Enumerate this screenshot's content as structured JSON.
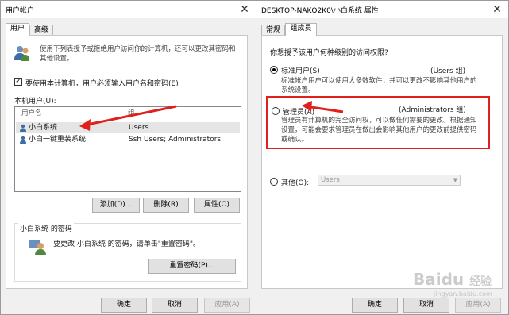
{
  "left_window": {
    "title": "用户帐户",
    "close_glyph": "✕",
    "tabs": [
      {
        "label": "用户"
      },
      {
        "label": "高级"
      }
    ],
    "intro_text": "使用下列表授予或拒绝用户访问你的计算机，还可以更改其密码和其他设置。",
    "require_login_checkbox": {
      "checked": true,
      "check_glyph": "✓",
      "label": "要使用本计算机，用户必须输入用户名和密码(E)"
    },
    "users_label": "本机用户(U):",
    "table": {
      "headers": [
        "用户名",
        "组"
      ],
      "rows": [
        {
          "name": "小白系统",
          "group": "Users",
          "selected": true
        },
        {
          "name": "小白一键重装系统",
          "group": "Ssh Users; Administrators",
          "selected": false
        }
      ]
    },
    "list_buttons": {
      "add": "添加(D)...",
      "remove": "删除(R)",
      "properties": "属性(O)"
    },
    "password_group": {
      "title": "小白系统 的密码",
      "text": "要更改 小白系统 的密码，请单击\"重置密码\"。",
      "reset_button": "重置密码(P)..."
    },
    "footer": {
      "ok": "确定",
      "cancel": "取消",
      "apply": "应用(A)"
    }
  },
  "right_window": {
    "title": "DESKTOP-NAKQ2K0\\小白系统 属性",
    "close_glyph": "✕",
    "tabs": [
      {
        "label": "常规"
      },
      {
        "label": "组成员"
      }
    ],
    "question": "你想授予该用户何种级别的访问权限?",
    "options": [
      {
        "label": "标准用户(S)",
        "group": "(Users 组)",
        "desc": "标准帐户用户可以使用大多数软件，并可以更改不影响其他用户的系统设置。",
        "selected": true
      },
      {
        "label": "管理员(A)",
        "group": "(Administrators 组)",
        "desc": "管理员有计算机的完全访问权，可以做任何需要的更改。根据通知设置，可能会要求管理员在做出会影响其他用户的更改前提供密码或确认。",
        "selected": false
      },
      {
        "label": "其他(O):",
        "select_value": "Users",
        "selected": false
      }
    ],
    "footer": {
      "ok": "确定",
      "cancel": "取消",
      "apply": "应用(A)"
    }
  },
  "watermark": {
    "brand": "Baidu",
    "suffix": "经验",
    "site": "jingyan.baidu.com"
  },
  "colors": {
    "annotation_red": "#e0201b",
    "accent_blue": "#0078d7"
  }
}
